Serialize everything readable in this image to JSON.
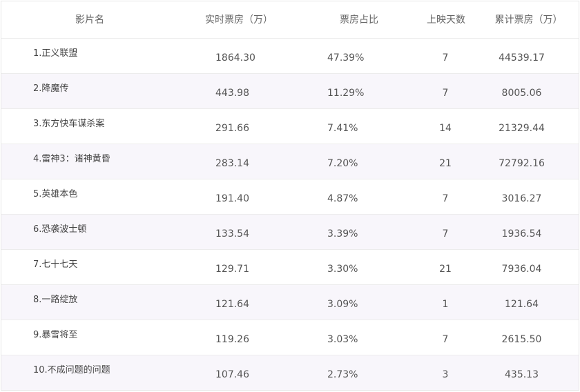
{
  "table": {
    "headers": {
      "name": "影片名",
      "realtime": "实时票房（万）",
      "share": "票房占比",
      "days": "上映天数",
      "total": "累计票房（万）"
    },
    "rows": [
      {
        "name": "1.正义联盟",
        "realtime": "1864.30",
        "share": "47.39%",
        "days": "7",
        "total": "44539.17"
      },
      {
        "name": "2.降魔传",
        "realtime": "443.98",
        "share": "11.29%",
        "days": "7",
        "total": "8005.06"
      },
      {
        "name": "3.东方快车谋杀案",
        "realtime": "291.66",
        "share": "7.41%",
        "days": "14",
        "total": "21329.44"
      },
      {
        "name": "4.雷神3：诸神黄昏",
        "realtime": "283.14",
        "share": "7.20%",
        "days": "21",
        "total": "72792.16"
      },
      {
        "name": "5.英雄本色",
        "realtime": "191.40",
        "share": "4.87%",
        "days": "7",
        "total": "3016.27"
      },
      {
        "name": "6.恐袭波士顿",
        "realtime": "133.54",
        "share": "3.39%",
        "days": "7",
        "total": "1936.54"
      },
      {
        "name": "7.七十七天",
        "realtime": "129.71",
        "share": "3.30%",
        "days": "21",
        "total": "7936.04"
      },
      {
        "name": "8.一路绽放",
        "realtime": "121.64",
        "share": "3.09%",
        "days": "1",
        "total": "121.64"
      },
      {
        "name": "9.暴雪将至",
        "realtime": "119.26",
        "share": "3.03%",
        "days": "7",
        "total": "2615.50"
      },
      {
        "name": "10.不成问题的问题",
        "realtime": "107.46",
        "share": "2.73%",
        "days": "3",
        "total": "435.13"
      }
    ]
  },
  "colors": {
    "row_alt": "#f8f6fb",
    "border": "#ececec",
    "text": "#555555"
  }
}
